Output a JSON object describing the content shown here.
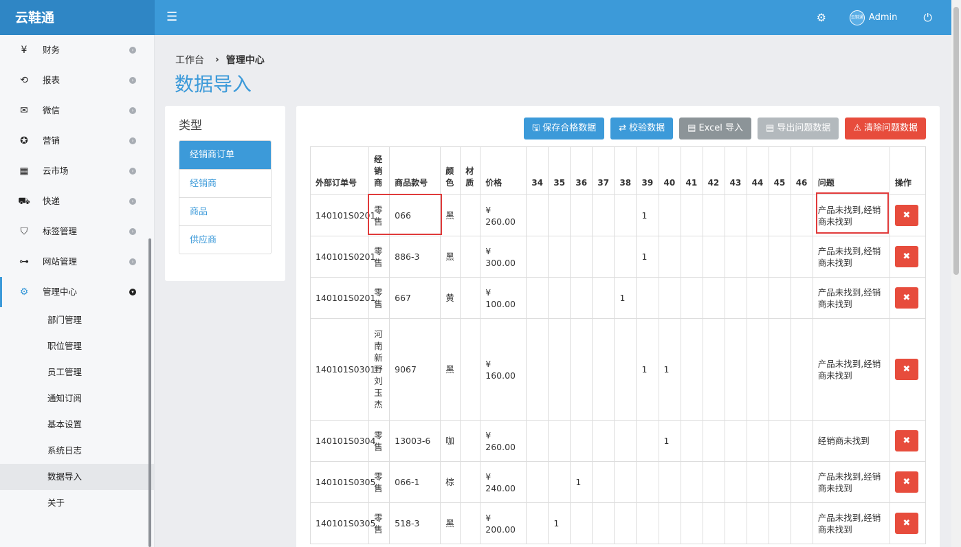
{
  "app": {
    "brand": "云鞋通"
  },
  "topbar": {
    "menu_icon": "☰",
    "settings_icon": "⚙",
    "avatar_text": "云鞋通",
    "user": "Admin",
    "power_icon": "⏻"
  },
  "sidebar": {
    "items": [
      {
        "icon": "¥",
        "label": "财务"
      },
      {
        "icon": "⟲",
        "label": "报表"
      },
      {
        "icon": "✉",
        "label": "微信"
      },
      {
        "icon": "✪",
        "label": "营销"
      },
      {
        "icon": "▦",
        "label": "云市场"
      },
      {
        "icon": "⛟",
        "label": "快递"
      },
      {
        "icon": "⛉",
        "label": "标签管理"
      },
      {
        "icon": "⊶",
        "label": "网站管理"
      },
      {
        "icon": "⚙",
        "label": "管理中心"
      }
    ],
    "subitems": [
      "部门管理",
      "职位管理",
      "员工管理",
      "通知订阅",
      "基本设置",
      "系统日志",
      "数据导入",
      "关于"
    ],
    "selected_subitem": "数据导入"
  },
  "breadcrumb": {
    "home": "工作台",
    "separator": "›",
    "current": "管理中心"
  },
  "page_title": "数据导入",
  "type_panel": {
    "title": "类型",
    "items": [
      "经销商订单",
      "经销商",
      "商品",
      "供应商"
    ],
    "active": "经销商订单"
  },
  "toolbar": {
    "save": "保存合格数据",
    "validate": "校验数据",
    "excel_import": "Excel 导入",
    "export_problems": "导出问题数据",
    "clear_problems": "清除问题数据"
  },
  "table": {
    "headers": {
      "order": "外部订单号",
      "dealer": "经销商",
      "sku": "商品款号",
      "color": "颜色",
      "material": "材质",
      "price": "价格",
      "problem": "问题",
      "action": "操作"
    },
    "sizes": [
      "34",
      "35",
      "36",
      "37",
      "38",
      "39",
      "40",
      "41",
      "42",
      "43",
      "44",
      "45",
      "46"
    ],
    "rows": [
      {
        "order": "140101S0201",
        "dealer": "零售",
        "sku": "066",
        "color": "黑",
        "material": "",
        "price": "¥ 260.00",
        "sizes": [
          "",
          "",
          "",
          "",
          "",
          "1",
          "",
          "",
          "",
          "",
          "",
          "",
          ""
        ],
        "problem": "产品未找到,经销商未找到"
      },
      {
        "order": "140101S0201",
        "dealer": "零售",
        "sku": "886-3",
        "color": "黑",
        "material": "",
        "price": "¥ 300.00",
        "sizes": [
          "",
          "",
          "",
          "",
          "",
          "1",
          "",
          "",
          "",
          "",
          "",
          "",
          ""
        ],
        "problem": "产品未找到,经销商未找到"
      },
      {
        "order": "140101S0201",
        "dealer": "零售",
        "sku": "667",
        "color": "黄",
        "material": "",
        "price": "¥ 100.00",
        "sizes": [
          "",
          "",
          "",
          "",
          "1",
          "",
          "",
          "",
          "",
          "",
          "",
          "",
          ""
        ],
        "problem": "产品未找到,经销商未找到"
      },
      {
        "order": "140101S0301",
        "dealer": "河南新野刘玉杰",
        "sku": "9067",
        "color": "黑",
        "material": "",
        "price": "¥ 160.00",
        "sizes": [
          "",
          "",
          "",
          "",
          "",
          "1",
          "1",
          "",
          "",
          "",
          "",
          "",
          ""
        ],
        "problem": "产品未找到,经销商未找到"
      },
      {
        "order": "140101S0304",
        "dealer": "零售",
        "sku": "13003-6",
        "color": "咖",
        "material": "",
        "price": "¥ 260.00",
        "sizes": [
          "",
          "",
          "",
          "",
          "",
          "",
          "1",
          "",
          "",
          "",
          "",
          "",
          ""
        ],
        "problem": "经销商未找到"
      },
      {
        "order": "140101S0305",
        "dealer": "零售",
        "sku": "066-1",
        "color": "棕",
        "material": "",
        "price": "¥ 240.00",
        "sizes": [
          "",
          "",
          "1",
          "",
          "",
          "",
          "",
          "",
          "",
          "",
          "",
          "",
          ""
        ],
        "problem": "产品未找到,经销商未找到"
      },
      {
        "order": "140101S0305",
        "dealer": "零售",
        "sku": "518-3",
        "color": "黑",
        "material": "",
        "price": "¥ 200.00",
        "sizes": [
          "",
          "1",
          "",
          "",
          "",
          "",
          "",
          "",
          "",
          "",
          "",
          "",
          ""
        ],
        "problem": "产品未找到,经销商未找到"
      }
    ],
    "delete_icon": "✖"
  },
  "colors": {
    "primary": "#3c9ad9",
    "brand_bg": "#2f86c5",
    "danger": "#e74c3c",
    "gray": "#8c9498",
    "light_gray": "#b3b9bd",
    "highlight": "#e03a3a"
  }
}
